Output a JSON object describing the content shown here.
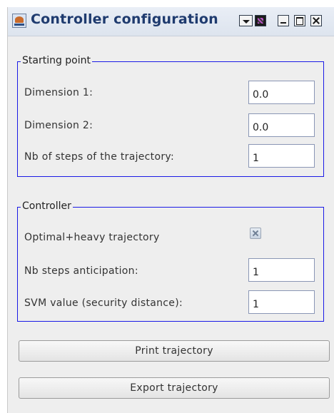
{
  "window": {
    "title": "Controller configuration"
  },
  "starting_point": {
    "title": "Starting point",
    "dimension1_label": "Dimension 1:",
    "dimension1_value": "0.0",
    "dimension2_label": "Dimension 2:",
    "dimension2_value": "0.0",
    "steps_label": "Nb of steps of the trajectory:",
    "steps_value": "1"
  },
  "controller": {
    "title": "Controller",
    "optimal_label": "Optimal+heavy trajectory",
    "optimal_checked": true,
    "anticipation_label": "Nb steps anticipation:",
    "anticipation_value": "1",
    "svm_label": "SVM value (security distance):",
    "svm_value": "1"
  },
  "buttons": {
    "print": "Print trajectory",
    "export": "Export trajectory"
  }
}
